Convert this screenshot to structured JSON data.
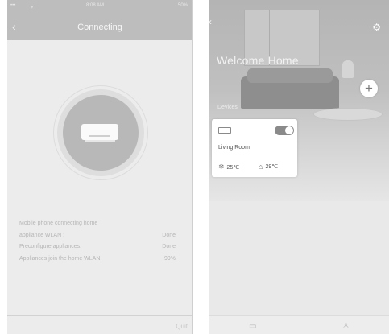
{
  "left": {
    "status": {
      "signal": "•••",
      "wifi": "ᯤ",
      "time": "8:08 AM",
      "battery": "50%"
    },
    "header": {
      "back_icon": "‹",
      "title": "Connecting"
    },
    "icons": {
      "appliance": "ac-unit-icon"
    },
    "progress": [
      {
        "label": "Mobile phone connecting home",
        "value": ""
      },
      {
        "label": "appliance WLAN :",
        "value": "Done"
      },
      {
        "label": "Preconfigure appliances:",
        "value": "Done"
      },
      {
        "label": "Appliances join the home WLAN:",
        "value": "99%"
      }
    ],
    "footer": {
      "quit_label": "Quit"
    }
  },
  "right": {
    "back_icon": "‹",
    "settings_icon": "⚙",
    "welcome": "Welcome Home",
    "add_icon": "+",
    "devices_label": "Devices",
    "device": {
      "name": "Living Room",
      "on": true,
      "set_temp_icon": "❄",
      "set_temp": "25℃",
      "indoor_icon": "⌂",
      "indoor_temp": "29℃"
    },
    "tabbar": {
      "devices_icon": "▭",
      "profile_icon": "♙"
    }
  }
}
